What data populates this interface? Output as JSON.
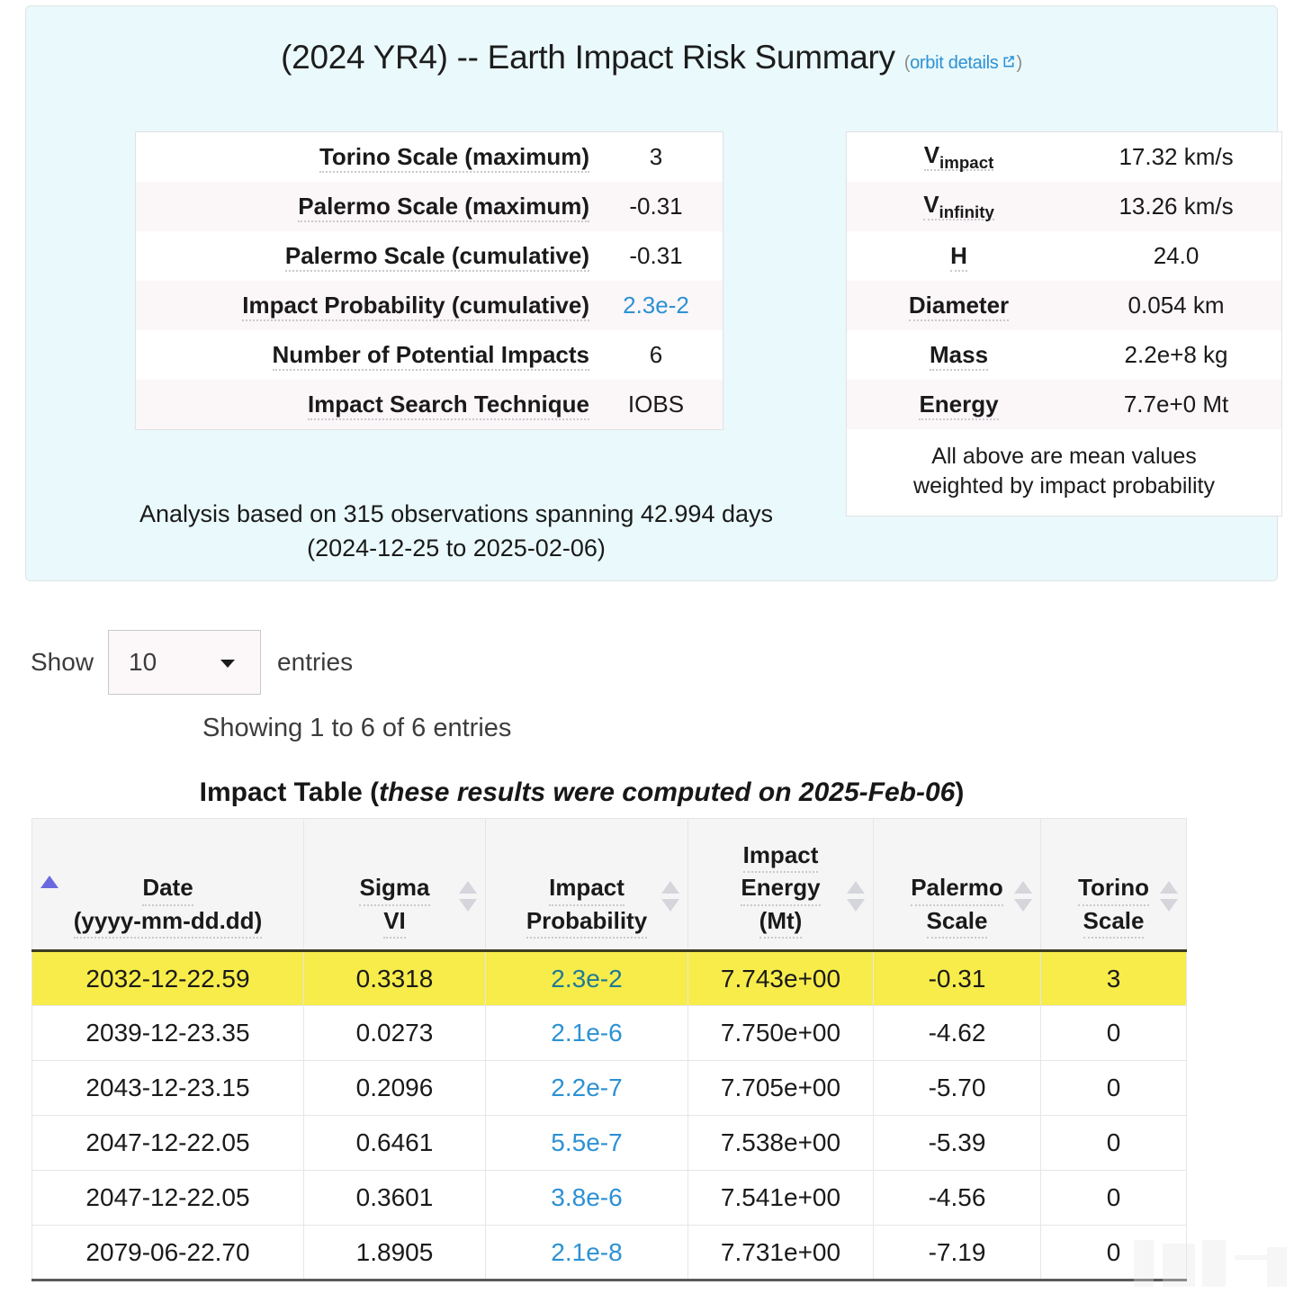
{
  "summary": {
    "title": "(2024 YR4) -- Earth Impact Risk Summary",
    "orbit_link_label": "orbit details",
    "paren_open": "(",
    "paren_close": ")",
    "risk_rows": [
      {
        "label": "Torino Scale (maximum)",
        "value": "3",
        "blue": false
      },
      {
        "label": "Palermo Scale (maximum)",
        "value": "-0.31",
        "blue": false
      },
      {
        "label": "Palermo Scale (cumulative)",
        "value": "-0.31",
        "blue": false
      },
      {
        "label": "Impact Probability (cumulative)",
        "value": "2.3e-2",
        "blue": true
      },
      {
        "label": "Number of Potential Impacts",
        "value": "6",
        "blue": false
      },
      {
        "label": "Impact Search Technique",
        "value": "IOBS",
        "blue": false
      }
    ],
    "physical_rows": [
      {
        "label_main": "V",
        "label_sub": "impact",
        "value": "17.32 km/s"
      },
      {
        "label_main": "V",
        "label_sub": "infinity",
        "value": "13.26 km/s"
      },
      {
        "label_main": "H",
        "label_sub": "",
        "value": "24.0"
      },
      {
        "label_main": "Diameter",
        "label_sub": "",
        "value": "0.054 km"
      },
      {
        "label_main": "Mass",
        "label_sub": "",
        "value": "2.2e+8 kg"
      },
      {
        "label_main": "Energy",
        "label_sub": "",
        "value": "7.7e+0 Mt"
      }
    ],
    "mean_note_line1": "All above are mean values",
    "mean_note_line2": "weighted by impact probability",
    "analysis_line1": "Analysis based on 315 observations spanning 42.994 days",
    "analysis_line2": "(2024-12-25 to 2025-02-06)"
  },
  "controls": {
    "show_label": "Show",
    "entries_value": "10",
    "entries_label": "entries",
    "info_text": "Showing 1 to 6 of 6 entries"
  },
  "impact_table": {
    "caption_prefix": "Impact Table (",
    "caption_italic": "these results were computed on 2025-Feb-06",
    "caption_suffix": ")",
    "columns": [
      {
        "line1": "Date",
        "line2": "(yyyy-mm-dd.dd)",
        "line3": "",
        "sort": "asc"
      },
      {
        "line1": "Sigma",
        "line2": "VI",
        "line3": "",
        "sort": "none"
      },
      {
        "line1": "Impact",
        "line2": "Probability",
        "line3": "",
        "sort": "none"
      },
      {
        "line1": "Impact",
        "line2": "Energy",
        "line3": "(Mt)",
        "sort": "none"
      },
      {
        "line1": "Palermo",
        "line2": "Scale",
        "line3": "",
        "sort": "none"
      },
      {
        "line1": "Torino",
        "line2": "Scale",
        "line3": "",
        "sort": "none"
      }
    ],
    "rows": [
      {
        "date": "2032-12-22.59",
        "sigma": "0.3318",
        "probability": "2.3e-2",
        "energy": "7.743e+00",
        "palermo": "-0.31",
        "torino": "3",
        "highlight": true
      },
      {
        "date": "2039-12-23.35",
        "sigma": "0.0273",
        "probability": "2.1e-6",
        "energy": "7.750e+00",
        "palermo": "-4.62",
        "torino": "0",
        "highlight": false
      },
      {
        "date": "2043-12-23.15",
        "sigma": "0.2096",
        "probability": "2.2e-7",
        "energy": "7.705e+00",
        "palermo": "-5.70",
        "torino": "0",
        "highlight": false
      },
      {
        "date": "2047-12-22.05",
        "sigma": "0.6461",
        "probability": "5.5e-7",
        "energy": "7.538e+00",
        "palermo": "-5.39",
        "torino": "0",
        "highlight": false
      },
      {
        "date": "2047-12-22.05",
        "sigma": "0.3601",
        "probability": "3.8e-6",
        "energy": "7.541e+00",
        "palermo": "-4.56",
        "torino": "0",
        "highlight": false
      },
      {
        "date": "2079-06-22.70",
        "sigma": "1.8905",
        "probability": "2.1e-8",
        "energy": "7.731e+00",
        "palermo": "-7.19",
        "torino": "0",
        "highlight": false
      }
    ]
  },
  "colors": {
    "panel_bg": "#eaf9fb",
    "link_blue": "#2d91d4",
    "highlight_yellow": "#f7ec4a",
    "sort_active": "#6a6ae0"
  }
}
